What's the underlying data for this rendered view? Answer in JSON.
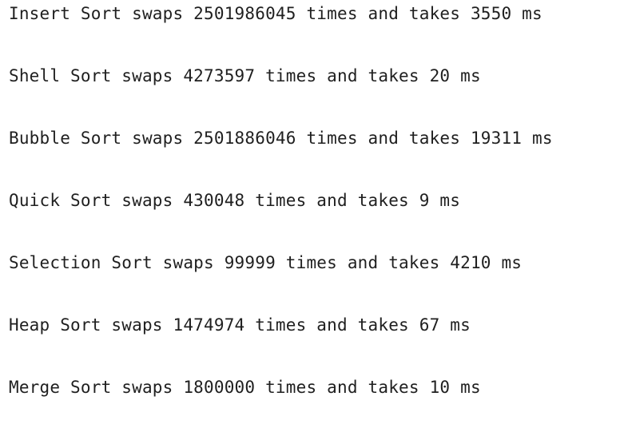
{
  "output": {
    "lines": [
      "Insert Sort swaps 2501986045 times and takes 3550 ms",
      "Shell Sort swaps 4273597 times and takes 20 ms",
      "Bubble Sort swaps 2501886046 times and takes 19311 ms",
      "Quick Sort swaps 430048 times and takes 9 ms",
      "Selection Sort swaps 99999 times and takes 4210 ms",
      "Heap Sort swaps 1474974 times and takes 67 ms",
      "Merge Sort swaps 1800000 times and takes 10 ms"
    ]
  }
}
